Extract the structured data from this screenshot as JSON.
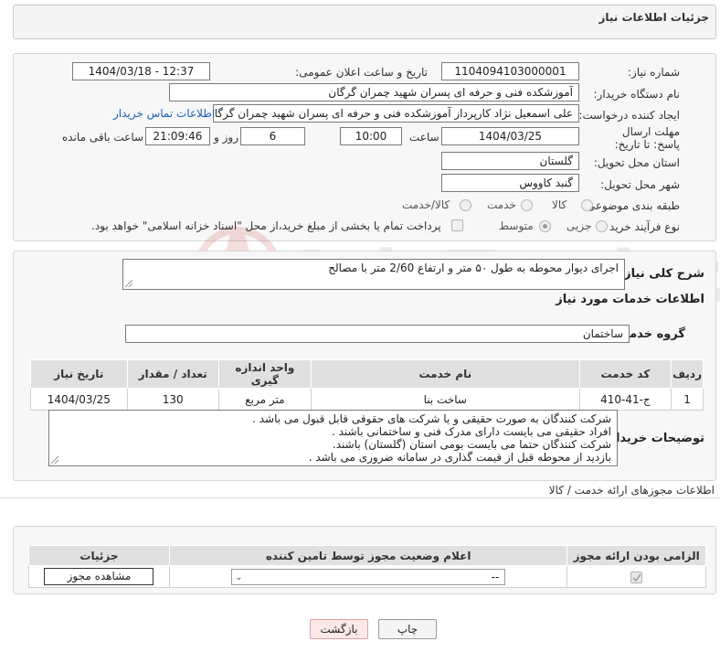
{
  "header": {
    "title": "جزئیات اطلاعات نیاز"
  },
  "info": {
    "need_number_label": "شماره نیاز:",
    "need_number": "1104094103000001",
    "announce_label": "تاریخ و ساعت اعلان عمومی:",
    "announce_value": "1404/03/18 - 12:37",
    "buyer_org_label": "نام دستگاه خریدار:",
    "buyer_org": "آموزشکده فنی و حرفه ای پسران شهید چمران گرگان",
    "creator_label": "ایجاد کننده درخواست:",
    "creator": "علی اسمعیل نژاد کارپرداز آموزشکده فنی و حرفه ای پسران شهید چمران گرگان",
    "contact_link": "اطلاعات تماس خریدار",
    "deadline_label": "مهلت ارسال پاسخ: تا تاریخ:",
    "deadline_date": "1404/03/25",
    "time_label": "ساعت",
    "deadline_time": "10:00",
    "days_value": "6",
    "days_label": "روز و",
    "remaining_time": "21:09:46",
    "remaining_label": "ساعت باقی مانده",
    "province_label": "استان محل تحویل:",
    "province": "گلستان",
    "city_label": "شهر محل تحویل:",
    "city": "گنبد کاووس",
    "category_label": "طبقه بندی موضوعی:",
    "category_options": [
      "کالا",
      "خدمت",
      "کالا/خدمت"
    ],
    "purchase_type_label": "نوع فرآیند خرید :",
    "purchase_options": [
      "جزیی",
      "متوسط"
    ],
    "payment_note": "پرداخت تمام یا بخشی از مبلغ خرید،از محل \"اسناد خزانه اسلامی\" خواهد بود."
  },
  "summary": {
    "label": "شرح کلی نیاز:",
    "text": "اجرای دیوار محوطه به طول ۵۰ متر و ارتفاع 2/60 متر با مصالح"
  },
  "services": {
    "section_title": "اطلاعات خدمات مورد نیاز",
    "group_label": "گروه خدمت:",
    "group_value": "ساختمان",
    "columns": [
      "ردیف",
      "کد خدمت",
      "نام خدمت",
      "واحد اندازه گیری",
      "تعداد / مقدار",
      "تاریخ نیاز"
    ],
    "rows": [
      [
        "1",
        "ج-41-410",
        "ساخت بنا",
        "متر مربع",
        "130",
        "1404/03/25"
      ]
    ]
  },
  "buyer_notes": {
    "label": "توضیحات خریدار:",
    "lines": [
      "شرکت کنندگان به صورت حقیقی و یا شرکت های حقوقی قابل قبول می باشد .",
      "افراد حقیقی می بایست دارای مدرک فنی و ساختمانی باشند .",
      "شرکت کنندگان حتما می بایست بومی استان (گلستان) باشند.",
      "بازدید از محوطه قبل از قیمت گذاری در سامانه ضروری می باشد ."
    ]
  },
  "permits": {
    "section_title": "اطلاعات مجوزهای ارائه خدمت / کالا",
    "columns": [
      "الزامی بودن ارائه مجوز",
      "اعلام وضعیت مجوز توسط تامین کننده",
      "جزئیات"
    ],
    "select_value": "--",
    "view_button": "مشاهده مجوز"
  },
  "actions": {
    "print": "چاپ",
    "back": "بازگشت"
  },
  "watermark": {
    "text": "AriaTender.neT"
  }
}
